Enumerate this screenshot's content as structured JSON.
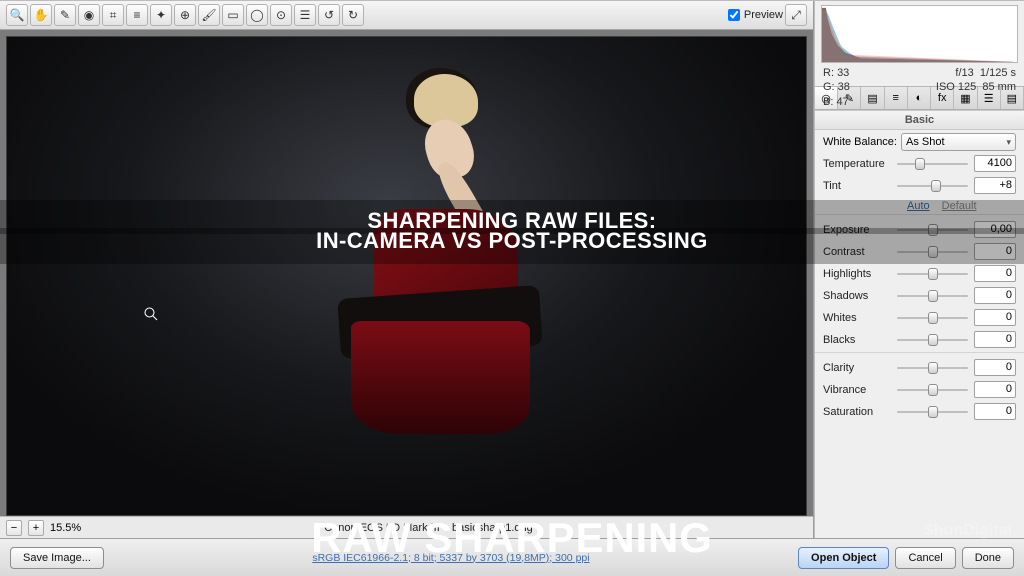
{
  "toolbar": {
    "preview_label": "Preview",
    "preview_checked": true,
    "tools": [
      "zoom",
      "hand",
      "eyedropper",
      "sample",
      "crop",
      "straighten",
      "spot",
      "redeye",
      "adjust-brush",
      "grad",
      "radial",
      "target",
      "prefs",
      "rotate-ccw",
      "rotate-cw"
    ]
  },
  "image_status": {
    "zoom": "15.5%",
    "caption": "Canon EOS 5D Mark III  –  basicsharp1.dng"
  },
  "histogram": {
    "rgb": {
      "R": "33",
      "G": "38",
      "B": "47"
    },
    "fstop": "f/13",
    "shutter": "1/125 s",
    "iso": "ISO 125",
    "focal": "85 mm"
  },
  "panel_tabs": [
    "◎",
    "✎",
    "▤",
    "≡",
    "◐",
    "fx",
    "▦",
    "☰",
    "▤"
  ],
  "basic": {
    "section_title": "Basic",
    "white_balance_label": "White Balance:",
    "white_balance_value": "As Shot",
    "auto_label": "Auto",
    "default_label": "Default",
    "sliders": [
      {
        "name": "Temperature",
        "value": "4100",
        "pos": 0.32,
        "key": "temperature"
      },
      {
        "name": "Tint",
        "value": "+8",
        "pos": 0.55,
        "key": "tint"
      },
      {
        "name": "Exposure",
        "value": "0,00",
        "pos": 0.5,
        "key": "exposure"
      },
      {
        "name": "Contrast",
        "value": "0",
        "pos": 0.5,
        "key": "contrast"
      },
      {
        "name": "Highlights",
        "value": "0",
        "pos": 0.5,
        "key": "highlights"
      },
      {
        "name": "Shadows",
        "value": "0",
        "pos": 0.5,
        "key": "shadows"
      },
      {
        "name": "Whites",
        "value": "0",
        "pos": 0.5,
        "key": "whites"
      },
      {
        "name": "Blacks",
        "value": "0",
        "pos": 0.5,
        "key": "blacks"
      },
      {
        "name": "Clarity",
        "value": "0",
        "pos": 0.5,
        "key": "clarity"
      },
      {
        "name": "Vibrance",
        "value": "0",
        "pos": 0.5,
        "key": "vibrance"
      },
      {
        "name": "Saturation",
        "value": "0",
        "pos": 0.5,
        "key": "saturation"
      }
    ]
  },
  "footer": {
    "save": "Save Image...",
    "info": "sRGB IEC61966-2.1; 8 bit; 5337 by 3703 (19,8MP); 300 ppi",
    "open": "Open Object",
    "cancel": "Cancel",
    "done": "Done"
  },
  "overlay": {
    "line1": "SHARPENING RAW FILES:",
    "line2": "IN-CAMERA VS POST-PROCESSING",
    "line3": "RAW SHARPENING",
    "watermark": "ShunDigital"
  }
}
